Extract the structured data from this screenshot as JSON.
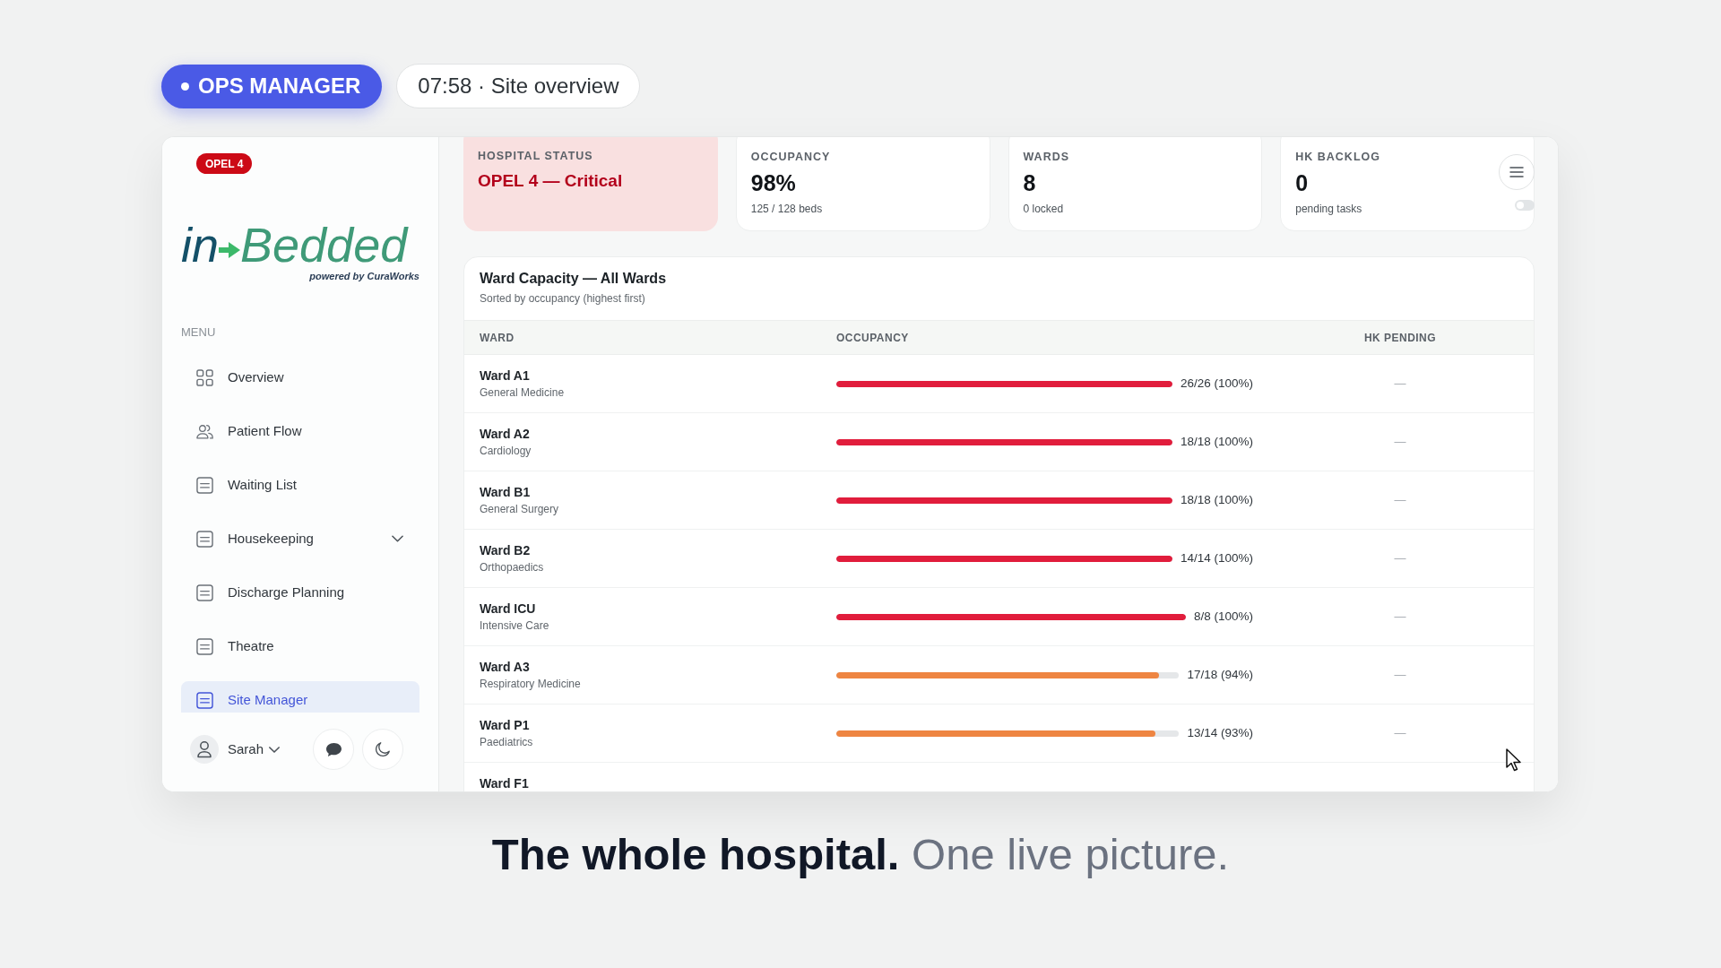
{
  "header": {
    "role_badge": {
      "label": "OPS MANAGER"
    },
    "time_pill": {
      "text": "07:58 · Site overview"
    }
  },
  "sidebar": {
    "status_badge": {
      "label": "OPEL 4"
    },
    "logo": {
      "prefix": "in",
      "name": "Bedded",
      "tagline": "powered by CuraWorks"
    },
    "menu_heading": "MENU",
    "items": [
      {
        "label": "Overview",
        "kind": "link",
        "selected": false
      },
      {
        "label": "Patient Flow",
        "kind": "link",
        "selected": false
      },
      {
        "label": "Waiting List",
        "kind": "link",
        "selected": false
      },
      {
        "label": "Housekeeping",
        "kind": "group",
        "selected": false
      },
      {
        "label": "Discharge Planning",
        "kind": "link",
        "selected": false
      },
      {
        "label": "Theatre",
        "kind": "link",
        "selected": false
      },
      {
        "label": "Site Manager",
        "kind": "link",
        "selected": true
      }
    ],
    "user": {
      "name": "Sarah"
    }
  },
  "stat_cards": [
    {
      "kind": "status",
      "label": "HOSPITAL STATUS",
      "value": "OPEL 4 — Critical"
    },
    {
      "kind": "metric",
      "label": "OCCUPANCY",
      "value": "98%",
      "detail": "125 / 128 beds"
    },
    {
      "kind": "metric",
      "label": "WARDS",
      "value": "8",
      "detail": "0 locked"
    },
    {
      "kind": "metric",
      "label": "HK BACKLOG",
      "value": "0",
      "detail": "pending tasks"
    }
  ],
  "toggle": {
    "on": false
  },
  "ward_table": {
    "title": "Ward Capacity — All Wards",
    "subtitle": "Sorted by occupancy (highest first)",
    "columns": [
      "WARD",
      "OCCUPANCY",
      "HK PENDING"
    ],
    "rows": [
      {
        "ward": "Ward A1",
        "department": "General Medicine",
        "level": 1,
        "reading": "26/26 (100%)",
        "hk_pending": "—",
        "color": "#e11d3c"
      },
      {
        "ward": "Ward A2",
        "department": "Cardiology",
        "level": 1,
        "reading": "18/18 (100%)",
        "hk_pending": "—",
        "color": "#e11d3c"
      },
      {
        "ward": "Ward B1",
        "department": "General Surgery",
        "level": 1,
        "reading": "18/18 (100%)",
        "hk_pending": "—",
        "color": "#e11d3c"
      },
      {
        "ward": "Ward B2",
        "department": "Orthopaedics",
        "level": 1,
        "reading": "14/14 (100%)",
        "hk_pending": "—",
        "color": "#e11d3c"
      },
      {
        "ward": "Ward ICU",
        "department": "Intensive Care",
        "level": 1,
        "reading": "8/8 (100%)",
        "hk_pending": "—",
        "color": "#e11d3c"
      },
      {
        "ward": "Ward A3",
        "department": "Respiratory Medicine",
        "level": 0.94,
        "reading": "17/18 (94%)",
        "hk_pending": "—",
        "color": "#ee8542"
      },
      {
        "ward": "Ward P1",
        "department": "Paediatrics",
        "level": 0.93,
        "reading": "13/14 (93%)",
        "hk_pending": "—",
        "color": "#ee8542"
      },
      {
        "ward": "Ward F1"
      }
    ]
  },
  "tagline": "**The whole hospital.** One live picture."
}
